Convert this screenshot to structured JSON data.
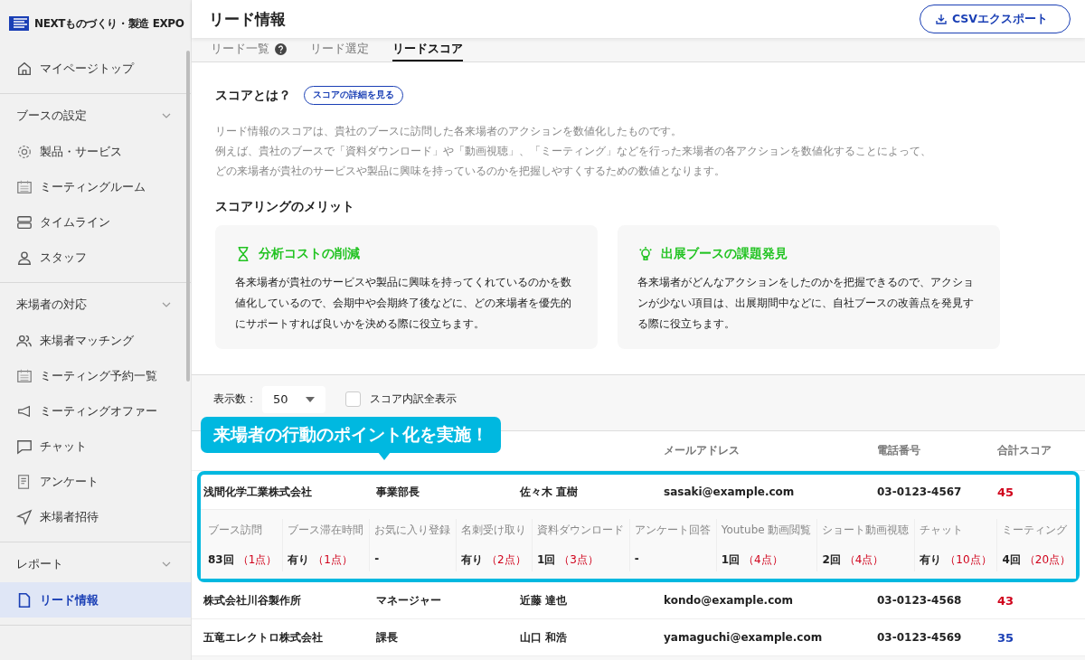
{
  "sidebar": {
    "logo": "NEXTものづくり・製造 EXPO",
    "top_item": {
      "label": "マイページトップ",
      "kind": "home",
      "selected": false
    },
    "sections": [
      {
        "title": "ブースの設定",
        "expanded": true,
        "items": [
          {
            "label": "製品・サービス",
            "kind": "gear",
            "selected": false
          },
          {
            "label": "ミーティングルーム",
            "kind": "calendar",
            "selected": false
          },
          {
            "label": "タイムライン",
            "kind": "rows",
            "selected": false
          },
          {
            "label": "スタッフ",
            "kind": "person",
            "selected": false
          }
        ]
      },
      {
        "title": "来場者の対応",
        "expanded": true,
        "items": [
          {
            "label": "来場者マッチング",
            "kind": "people",
            "selected": false
          },
          {
            "label": "ミーティング予約一覧",
            "kind": "list",
            "selected": false
          },
          {
            "label": "ミーティングオファー",
            "kind": "megaphone",
            "selected": false
          },
          {
            "label": "チャット",
            "kind": "chat",
            "selected": false
          },
          {
            "label": "アンケート",
            "kind": "survey",
            "selected": false
          },
          {
            "label": "来場者招待",
            "kind": "send",
            "selected": false
          }
        ]
      },
      {
        "title": "レポート",
        "expanded": true,
        "items": [
          {
            "label": "リード情報",
            "kind": "file",
            "selected": true
          }
        ]
      }
    ]
  },
  "header": {
    "title": "リード情報",
    "export_button": "CSVエクスポート"
  },
  "tabs": [
    {
      "label": "リード一覧",
      "help": true,
      "selected": false
    },
    {
      "label": "リード選定",
      "help": false,
      "selected": false
    },
    {
      "label": "リードスコア",
      "help": false,
      "selected": true
    }
  ],
  "about": {
    "title": "スコアとは？",
    "detail_button": "スコアの詳細を見る",
    "paragraph": [
      "リード情報のスコアは、貴社のブースに訪問した各来場者のアクションを数値化したものです。",
      "例えば、貴社のブースで「資料ダウンロード」や「動画視聴」、「ミーティング」などを行った来場者の各アクションを数値化することによって、",
      "どの来場者が貴社のサービスや製品に興味を持っているのかを把握しやすくするための数値となります。"
    ]
  },
  "merits": {
    "title": "スコアリングのメリット",
    "cards": [
      {
        "kind": "hourglass",
        "title": "分析コストの削減",
        "text": "各来場者が貴社のサービスや製品に興味を持ってくれているのかを数値化しているので、会期中や会期終了後などに、どの来場者を優先的にサポートすれば良いかを決める際に役立ちます。"
      },
      {
        "kind": "bulb",
        "title": "出展ブースの課題発見",
        "text": "各来場者がどんなアクションをしたのかを把握できるので、アクションが少ない項目は、出展期間中などに、自社ブースの改善点を発見する際に役立ちます。"
      }
    ]
  },
  "controls": {
    "per_page_label": "表示数：",
    "per_page": "50",
    "breakdown_label": "スコア内訳全表示",
    "breakdown_checked": false
  },
  "callout": "来場者の行動のポイント化を実施！",
  "table": {
    "columns": [
      "メールアドレス",
      "電話番号",
      "合計スコア"
    ],
    "rows": [
      {
        "company": "浅間化学工業株式会社",
        "title": "事業部長",
        "name": "佐々木 直樹",
        "email": "sasaki@example.com",
        "phone": "03-0123-4567",
        "score": "45",
        "color": "#d0021b",
        "expanded": true,
        "details": [
          {
            "label": "ブース訪問",
            "value": "83回",
            "points": "（1点）"
          },
          {
            "label": "ブース滞在時間",
            "value": "有り",
            "points": "（1点）"
          },
          {
            "label": "お気に入り登録",
            "value": "-"
          },
          {
            "label": "名刺受け取り",
            "value": "有り",
            "points": "（2点）"
          },
          {
            "label": "資料ダウンロード",
            "value": "1回",
            "points": "（3点）"
          },
          {
            "label": "アンケート回答",
            "value": "-"
          },
          {
            "label": "Youtube 動画閲覧",
            "value": "1回",
            "points": "（4点）"
          },
          {
            "label": "ショート動画視聴",
            "value": "2回",
            "points": "（4点）"
          },
          {
            "label": "チャット",
            "value": "有り",
            "points": "（10点）"
          },
          {
            "label": "ミーティング",
            "value": "4回",
            "points": "（20点）"
          }
        ]
      },
      {
        "company": "株式会社川谷製作所",
        "title": "マネージャー",
        "name": "近藤 達也",
        "email": "kondo@example.com",
        "phone": "03-0123-4568",
        "score": "43",
        "color": "#d0021b",
        "expanded": false
      },
      {
        "company": "五竜エレクトロ株式会社",
        "title": "課長",
        "name": "山口 和浩",
        "email": "yamaguchi@example.com",
        "phone": "03-0123-4569",
        "score": "35",
        "color": "#1a3fb5",
        "expanded": false
      }
    ]
  }
}
